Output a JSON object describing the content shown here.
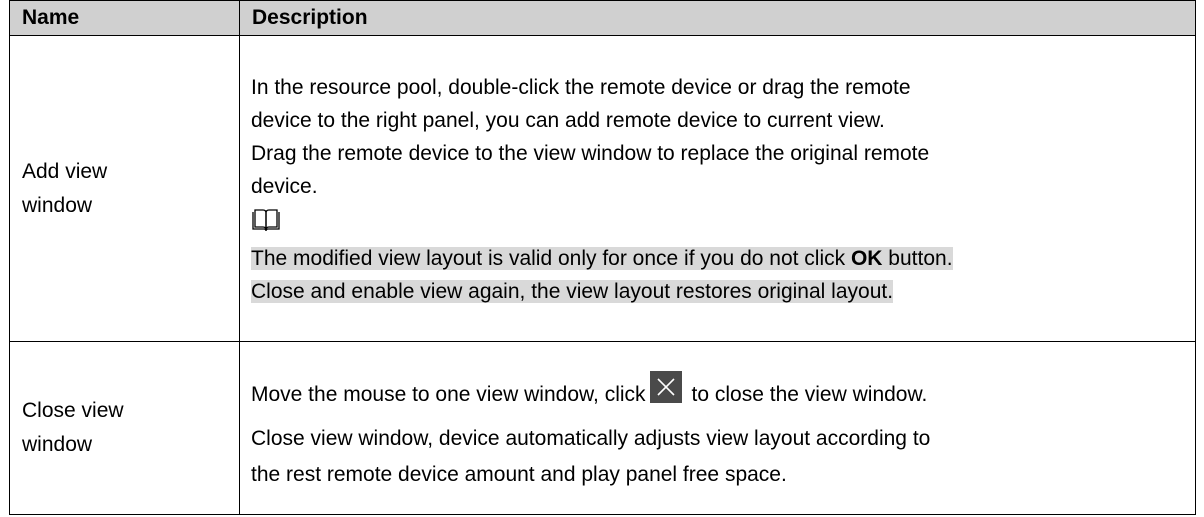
{
  "table": {
    "headers": {
      "name": "Name",
      "description": "Description"
    },
    "rows": [
      {
        "name": "Add view window",
        "lines": [
          "In the resource pool, double-click the remote device or drag the remote",
          "device to the right panel, you can add remote device to current view.",
          "Drag the remote device to the view window to replace the original remote",
          "device."
        ],
        "note_icon": "book-note-icon",
        "note": {
          "line1_before": "The modified view layout is valid only for once if you do not click ",
          "line1_bold": "OK",
          "line1_after": " button.",
          "line2": "Close and enable view again, the view layout restores original layout."
        }
      },
      {
        "name": "Close view window",
        "line1_before": "Move the mouse to one view window, click",
        "close_icon": "close-icon",
        "line1_after": "to close the view window.",
        "lines": [
          "Close view window, device automatically adjusts view layout according to",
          "the rest remote device amount and play panel free space."
        ]
      }
    ]
  },
  "colors": {
    "header_bg": "#d0d0d0",
    "note_highlight": "#d9d9d9",
    "close_icon_bg": "#4a4a4a"
  }
}
